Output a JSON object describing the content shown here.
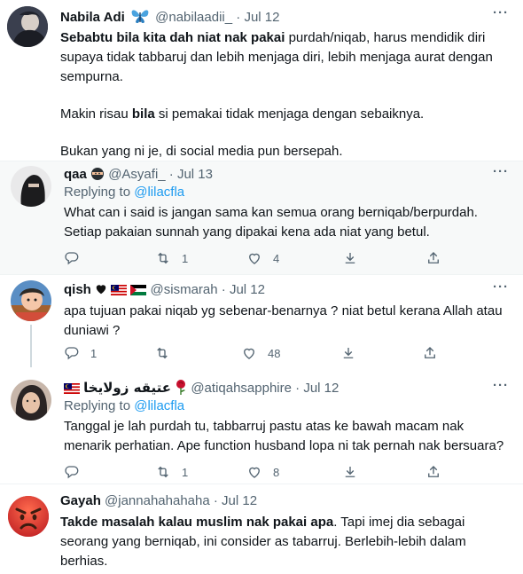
{
  "tweets": [
    {
      "name": "Nabila Adi",
      "handle": "@nabilaadii_",
      "sep": "·",
      "date": "Jul 12",
      "more": "···",
      "p1_bold": "Sebabtu bila kita dah niat nak pakai",
      "p1_rest": " purdah/niqab, harus mendidik diri",
      "p1_l2": "supaya tidak tabbaruj dan lebih menjaga diri, lebih menjaga aurat dengan",
      "p1_l3": "sempurna.",
      "p2_pre": "Makin risau ",
      "p2_bold": "bila",
      "p2_post": " si pemakai tidak menjaga dengan sebaiknya.",
      "p3": "Bukan yang ni je, di social media pun bersepah."
    },
    {
      "name": "qaa",
      "handle": "@Asyafi_",
      "sep": "·",
      "date": "Jul 13",
      "more": "···",
      "replying_label": "Replying to",
      "replying_handle": "@lilacfla",
      "l1": "What can i said is jangan sama kan semua orang berniqab/berpurdah.",
      "l2": "Setiap pakaian sunnah yang dipakai kena ada niat yang betul.",
      "retweets": "1",
      "likes": "4"
    },
    {
      "name": "qish",
      "handle": "@sismarah",
      "sep": "·",
      "date": "Jul 12",
      "more": "···",
      "l1": "apa tujuan pakai niqab yg sebenar-benarnya ? niat betul kerana Allah atau",
      "l2": "duniawi ?",
      "replies": "1",
      "likes": "48"
    },
    {
      "name": "عتيقه زولايخا",
      "handle": "@atiqahsapphire",
      "sep": "·",
      "date": "Jul 12",
      "more": "···",
      "replying_label": "Replying to",
      "replying_handle": "@lilacfla",
      "l1": "Tanggal je lah purdah tu, tabbarruj pastu atas ke bawah macam nak",
      "l2": "menarik perhatian. Ape function husband lopa ni tak pernah nak bersuara?",
      "retweets": "1",
      "likes": "8"
    },
    {
      "name": "Gayah",
      "handle": "@jannahahahaha",
      "sep": "·",
      "date": "Jul 12",
      "l1_bold": "Takde masalah kalau muslim nak pakai apa",
      "l1_rest": ". Tapi imej dia sebagai",
      "l2": "seorang yang berniqab, ini consider as tabarruj. Berlebih-lebih dalam",
      "l3": "berhias."
    }
  ],
  "colors": {
    "accent": "#1d9bf0",
    "muted": "#536471",
    "text": "#0f1419"
  },
  "icons": [
    "butterfly-icon",
    "ninja-emoji-icon",
    "heart-emoji-icon",
    "malaysia-flag-icon",
    "palestine-flag-icon",
    "rose-icon",
    "angry-face-icon",
    "reply-icon",
    "retweet-icon",
    "like-icon",
    "share-icon",
    "upload-icon"
  ]
}
